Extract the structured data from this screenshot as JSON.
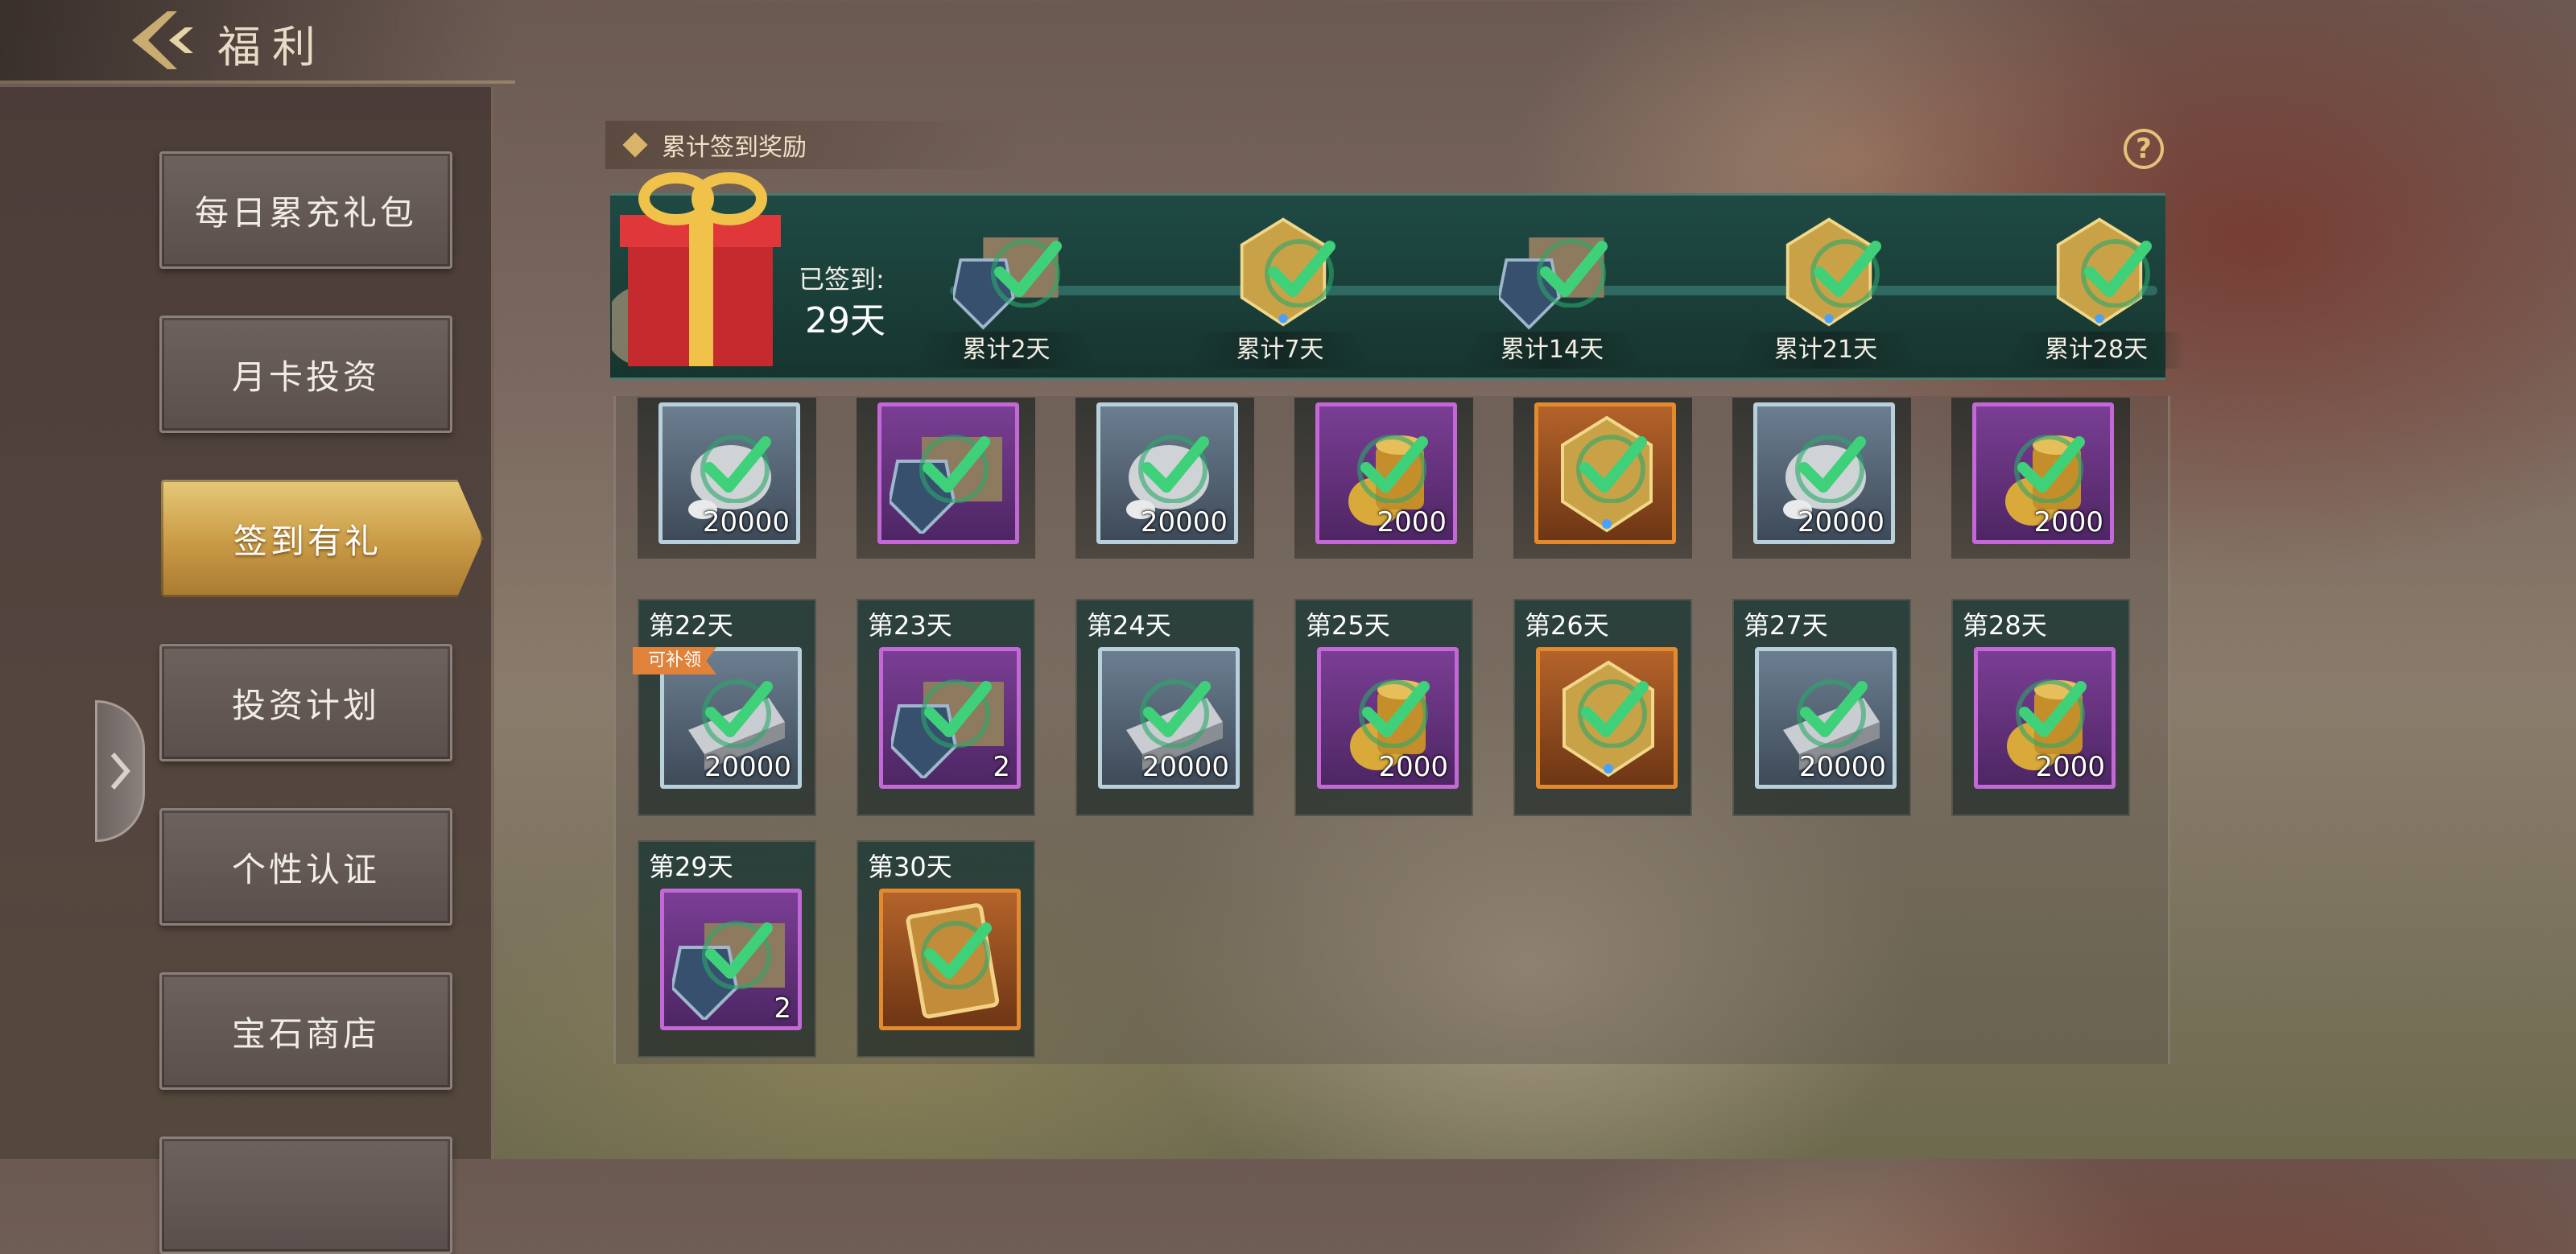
{
  "header": {
    "title": "福利"
  },
  "sidebar": {
    "items": [
      {
        "label": "每日累充礼包",
        "active": false
      },
      {
        "label": "月卡投资",
        "active": false
      },
      {
        "label": "签到有礼",
        "active": true
      },
      {
        "label": "投资计划",
        "active": false
      },
      {
        "label": "个性认证",
        "active": false
      },
      {
        "label": "宝石商店",
        "active": false
      }
    ]
  },
  "section": {
    "title": "累计签到奖励"
  },
  "summary": {
    "signed_label": "已签到:",
    "signed_value": "29天"
  },
  "milestones": [
    {
      "label": "累计2天",
      "icon": "chest-icon",
      "claimed": true
    },
    {
      "label": "累计7天",
      "icon": "helmet-icon",
      "claimed": true
    },
    {
      "label": "累计14天",
      "icon": "chest-icon",
      "claimed": true
    },
    {
      "label": "累计21天",
      "icon": "helmet-icon",
      "claimed": true
    },
    {
      "label": "累计28天",
      "icon": "helmet-icon",
      "claimed": true
    }
  ],
  "rows": [
    [
      {
        "day": "",
        "qty": "20000",
        "rarity": "silver",
        "icon": "stone-icon"
      },
      {
        "day": "",
        "qty": "",
        "rarity": "purple",
        "icon": "chest-icon"
      },
      {
        "day": "",
        "qty": "20000",
        "rarity": "silver",
        "icon": "stone-icon"
      },
      {
        "day": "",
        "qty": "2000",
        "rarity": "purple",
        "icon": "gold-coins-icon"
      },
      {
        "day": "",
        "qty": "",
        "rarity": "orange",
        "icon": "helmet-icon"
      },
      {
        "day": "",
        "qty": "20000",
        "rarity": "silver",
        "icon": "stone-icon"
      },
      {
        "day": "",
        "qty": "2000",
        "rarity": "purple",
        "icon": "gold-coins-icon"
      }
    ],
    [
      {
        "day": "第22天",
        "qty": "20000",
        "rarity": "silver",
        "icon": "iron-ingot-icon",
        "badge": "可补领"
      },
      {
        "day": "第23天",
        "qty": "2",
        "rarity": "purple",
        "icon": "chest-icon"
      },
      {
        "day": "第24天",
        "qty": "20000",
        "rarity": "silver",
        "icon": "iron-ingot-icon"
      },
      {
        "day": "第25天",
        "qty": "2000",
        "rarity": "purple",
        "icon": "gold-coins-icon"
      },
      {
        "day": "第26天",
        "qty": "",
        "rarity": "orange",
        "icon": "helmet-icon"
      },
      {
        "day": "第27天",
        "qty": "20000",
        "rarity": "silver",
        "icon": "iron-ingot-icon"
      },
      {
        "day": "第28天",
        "qty": "2000",
        "rarity": "purple",
        "icon": "gold-coins-icon"
      }
    ],
    [
      {
        "day": "第29天",
        "qty": "2",
        "rarity": "purple",
        "icon": "chest-icon"
      },
      {
        "day": "第30天",
        "qty": "",
        "rarity": "orange",
        "icon": "card-icon"
      }
    ]
  ],
  "colors": {
    "gold": "#d8b56a",
    "check_green": "#3fd07a",
    "band_teal": "#1f4a44"
  }
}
